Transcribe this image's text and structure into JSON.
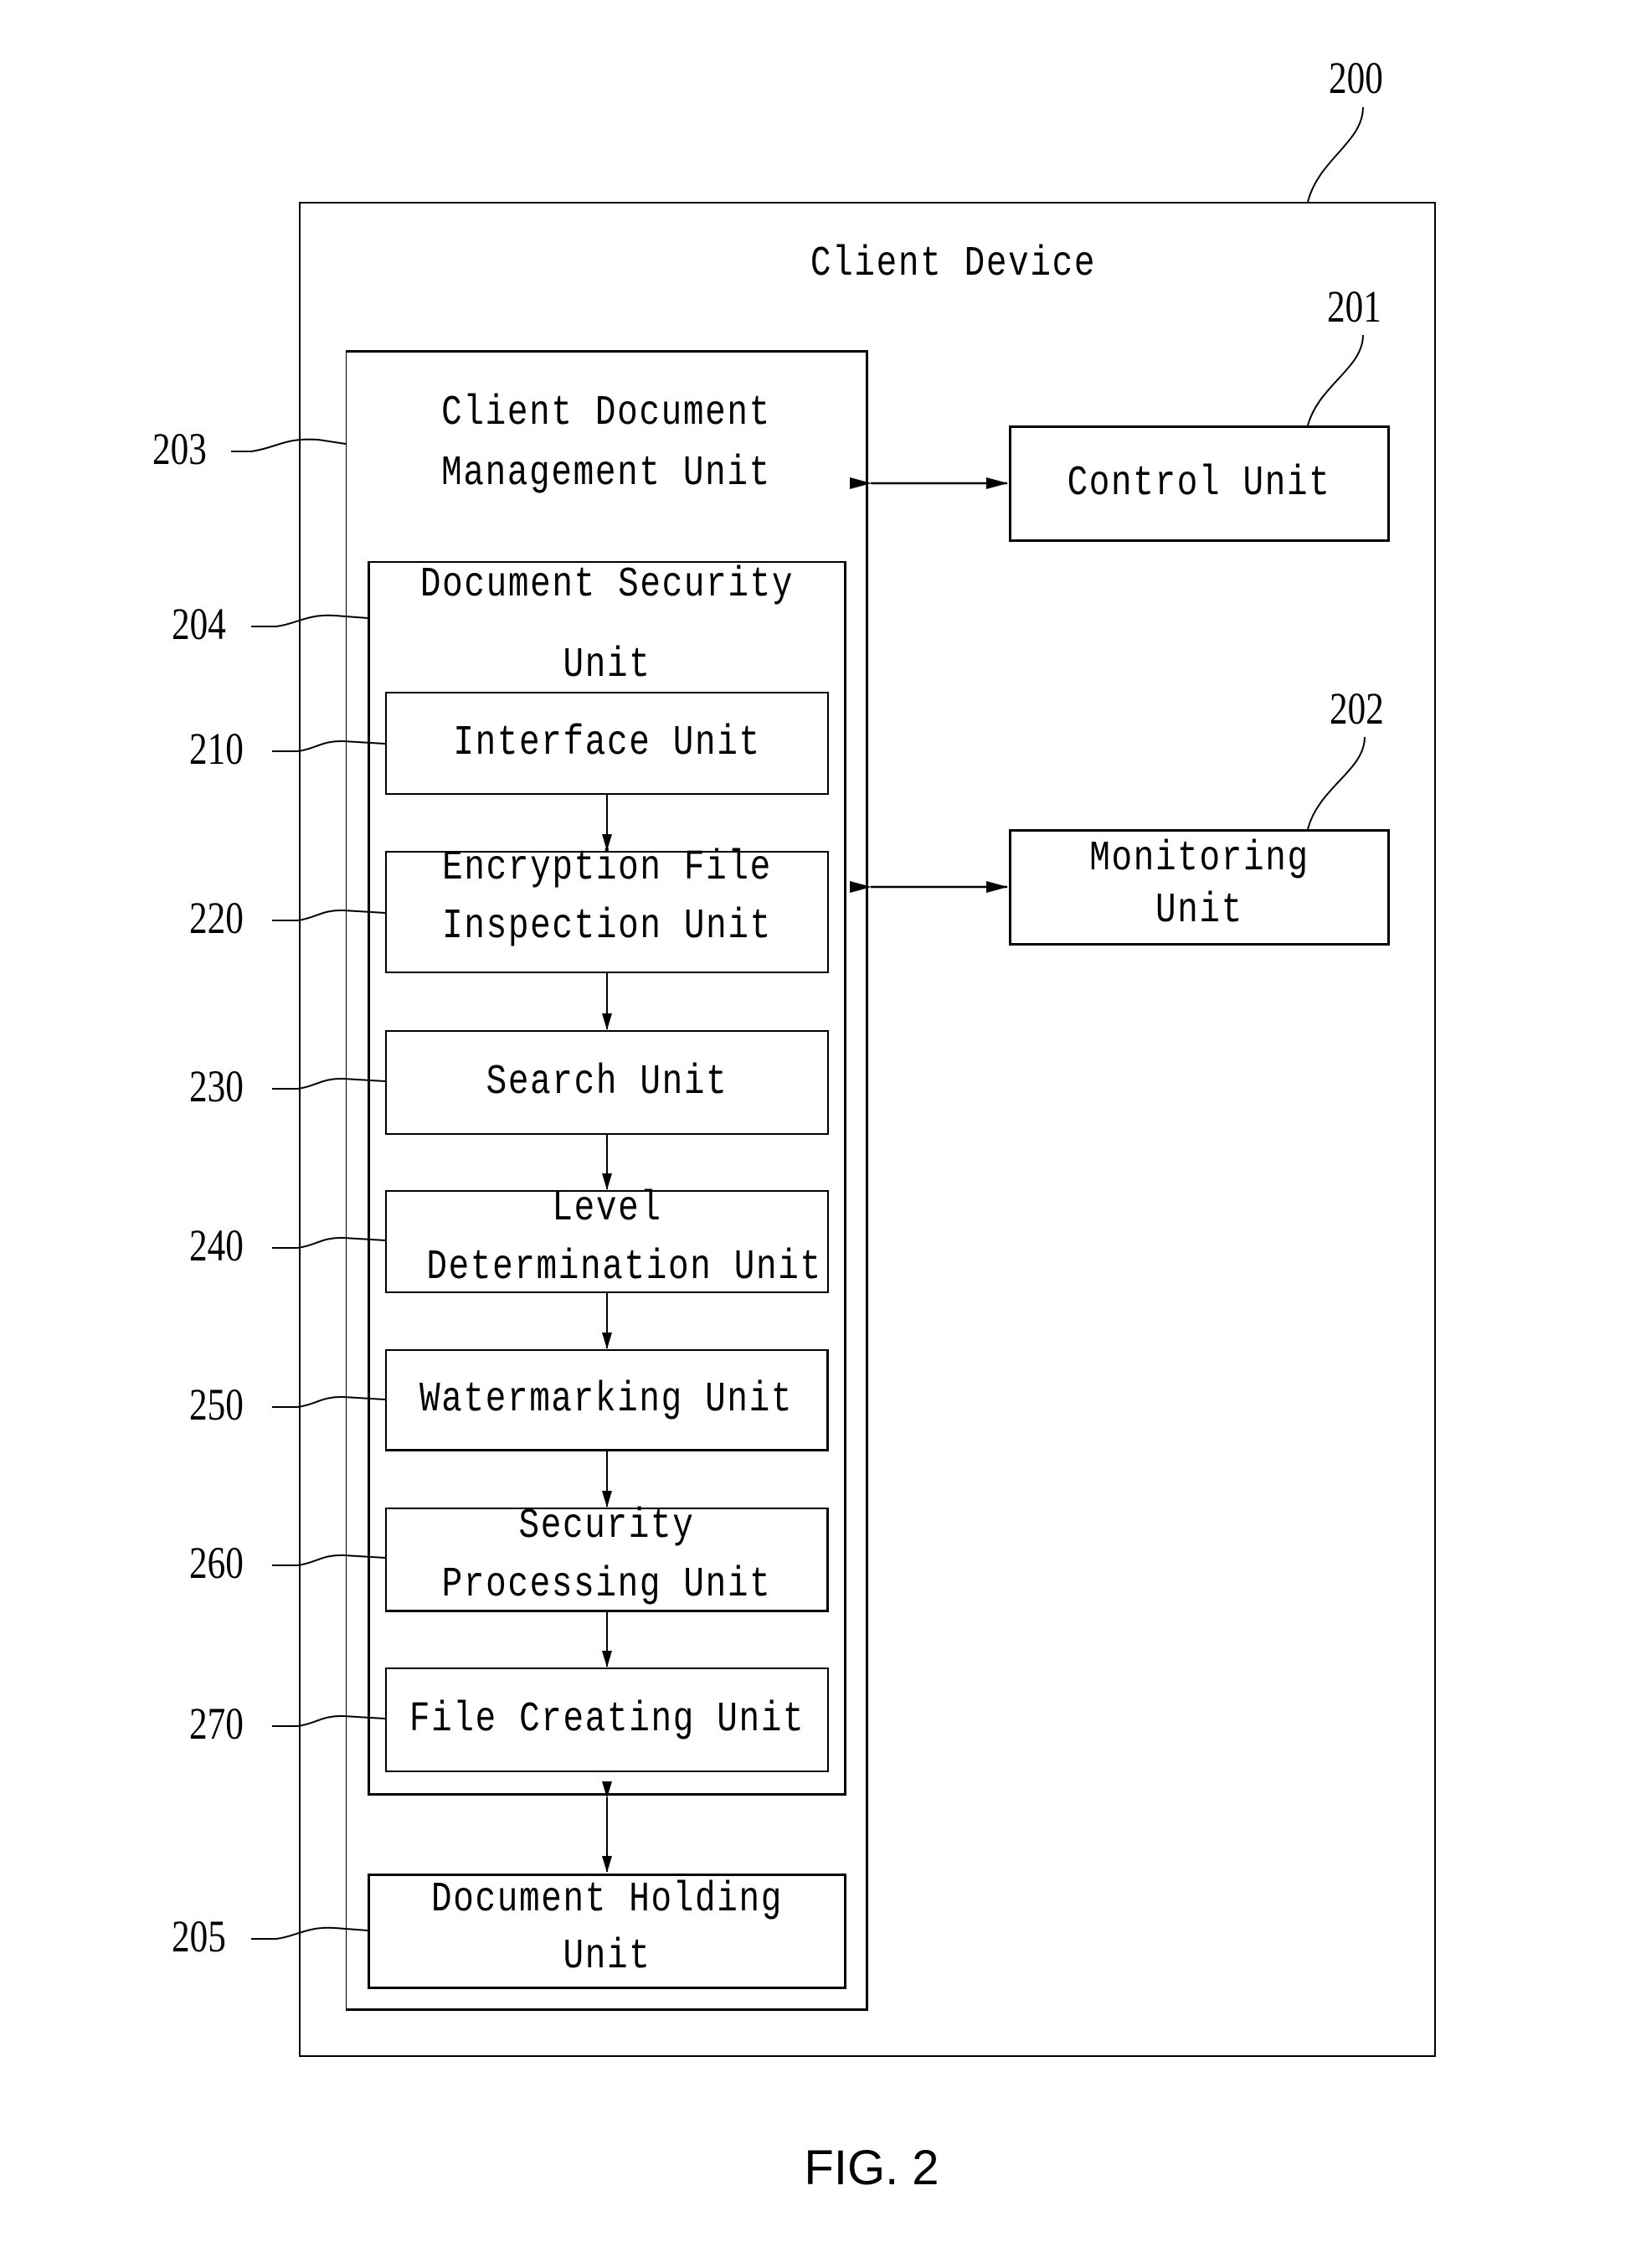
{
  "figure": {
    "caption": "FIG. 2",
    "client_device": {
      "ref": "200",
      "title": "Client Device"
    },
    "control_unit": {
      "ref": "201",
      "label": "Control Unit"
    },
    "monitoring_unit": {
      "ref": "202",
      "label_line1": "Monitoring",
      "label_line2": "Unit"
    },
    "client_document_management_unit": {
      "ref": "203",
      "label_line1": "Client Document",
      "label_line2": "Management Unit"
    },
    "document_security_unit": {
      "ref": "204",
      "label_line1": "Document Security",
      "label_line2": "Unit",
      "sub_units": [
        {
          "ref": "210",
          "label_line1": "Interface Unit",
          "label_line2": ""
        },
        {
          "ref": "220",
          "label_line1": "Encryption File",
          "label_line2": "Inspection Unit"
        },
        {
          "ref": "230",
          "label_line1": "Search Unit",
          "label_line2": ""
        },
        {
          "ref": "240",
          "label_line1": "Level",
          "label_line2": "Determination Unit"
        },
        {
          "ref": "250",
          "label_line1": "Watermarking Unit",
          "label_line2": ""
        },
        {
          "ref": "260",
          "label_line1": "Security",
          "label_line2": "Processing Unit"
        },
        {
          "ref": "270",
          "label_line1": "File Creating Unit",
          "label_line2": ""
        }
      ]
    },
    "document_holding_unit": {
      "ref": "205",
      "label_line1": "Document Holding",
      "label_line2": "Unit"
    }
  }
}
